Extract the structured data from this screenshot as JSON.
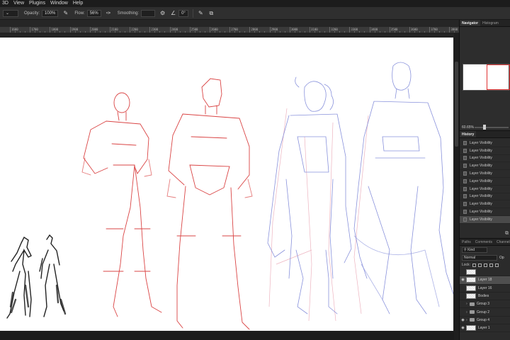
{
  "menu": [
    "3D",
    "View",
    "Plugins",
    "Window",
    "Help"
  ],
  "options": {
    "opacity_label": "Opacity:",
    "opacity_value": "100%",
    "flow_label": "Flow:",
    "flow_value": "56%",
    "smoothing_label": "Smoothing:",
    "smoothing_value": "",
    "angle_value": "0°"
  },
  "ruler": [
    "1600",
    "1700",
    "1800",
    "1900",
    "2000",
    "2100",
    "2200",
    "2300",
    "2400",
    "2500",
    "2600",
    "2700",
    "2800",
    "2900",
    "3000",
    "3100",
    "3200",
    "3300",
    "3400",
    "3500",
    "3600",
    "3700",
    "3800"
  ],
  "navigator": {
    "tabs": [
      "Navigator",
      "Histogram"
    ],
    "zoom": "60.65%"
  },
  "history": {
    "tab": "History",
    "items": [
      "Layer Visibility",
      "Layer Visibility",
      "Layer Visibility",
      "Layer Visibility",
      "Layer Visibility",
      "Layer Visibility",
      "Layer Visibility",
      "Layer Visibility",
      "Layer Visibility",
      "Layer Visibility",
      "Layer Visibility"
    ],
    "selected_index": 10
  },
  "layers": {
    "tabs": [
      "Paths",
      "Comments",
      "Channels"
    ],
    "filter_label": "Kind",
    "blend_mode": "Normal",
    "opacity_abbrev": "Op",
    "lock_label": "Lock:",
    "items": [
      {
        "name": "",
        "type": "layer",
        "visible": false,
        "selected": false
      },
      {
        "name": "Layer 18",
        "type": "layer",
        "visible": true,
        "selected": true
      },
      {
        "name": "Layer 16",
        "type": "layer",
        "visible": false,
        "selected": false
      },
      {
        "name": "Bodies",
        "type": "layer",
        "visible": false,
        "selected": false
      },
      {
        "name": "Group 3",
        "type": "group",
        "visible": false,
        "selected": false
      },
      {
        "name": "Group 2",
        "type": "group",
        "visible": false,
        "selected": false
      },
      {
        "name": "Group 4",
        "type": "group",
        "visible": true,
        "selected": false
      },
      {
        "name": "Layer 1",
        "type": "layer",
        "visible": true,
        "selected": false
      }
    ]
  },
  "colors": {
    "accent_red": "#d83a3a",
    "sketch_blue": "#7c86d8",
    "sketch_pink": "#e9a0b0",
    "ink_dark": "#222222"
  }
}
